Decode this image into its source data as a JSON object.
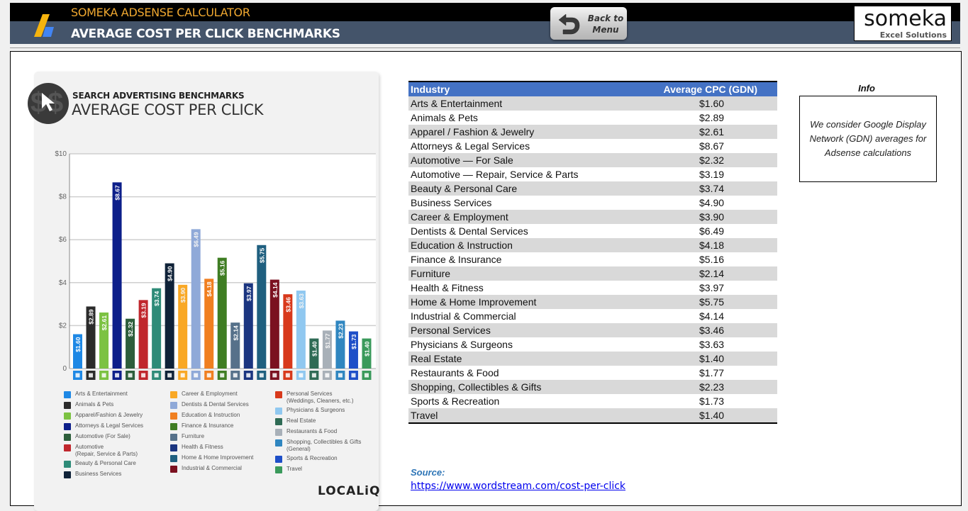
{
  "header": {
    "app_title": "SOMEKA ADSENSE CALCULATOR",
    "page_title": "AVERAGE COST PER CLICK BENCHMARKS",
    "back_button": {
      "line1": "Back to",
      "line2": "Menu"
    },
    "brand": {
      "name": "someka",
      "tagline": "Excel Solutions"
    }
  },
  "infographic": {
    "subtitle": "SEARCH ADVERTISING BENCHMARKS",
    "title": "AVERAGE COST PER CLICK",
    "brand": "LOCALiQ",
    "legend_columns": [
      [
        {
          "label": "Arts & Entertainment",
          "color": "#1e88e5"
        },
        {
          "label": "Animals & Pets",
          "color": "#2b2b2b"
        },
        {
          "label": "Apparel/Fashion & Jewelry",
          "color": "#7cc242"
        },
        {
          "label": "Attorneys & Legal Services",
          "color": "#0d1f8a"
        },
        {
          "label": "Automotive (For Sale)",
          "color": "#2d5e3b"
        },
        {
          "label": "Automotive",
          "label2": "(Repair, Service & Parts)",
          "color": "#c0272d"
        },
        {
          "label": "Beauty & Personal Care",
          "color": "#2e8b78"
        },
        {
          "label": "Business Services",
          "color": "#0f2238"
        }
      ],
      [
        {
          "label": "Career & Employment",
          "color": "#f9a825"
        },
        {
          "label": "Dentists & Dental Services",
          "color": "#8fa9d8"
        },
        {
          "label": "Education & Instruction",
          "color": "#f07f20"
        },
        {
          "label": "Finance & Insurance",
          "color": "#3f7d23"
        },
        {
          "label": "Furniture",
          "color": "#56718a"
        },
        {
          "label": "Health & Fitness",
          "color": "#1b3580"
        },
        {
          "label": "Home & Home Improvement",
          "color": "#1f5f7f"
        },
        {
          "label": "Industrial & Commercial",
          "color": "#7b1120"
        }
      ],
      [
        {
          "label": "Personal Services",
          "label2": "(Weddings, Cleaners, etc.)",
          "color": "#d8391b"
        },
        {
          "label": "Physicians & Surgeons",
          "color": "#90c8f0"
        },
        {
          "label": "Real Estate",
          "color": "#2f6b55"
        },
        {
          "label": "Restaurants & Food",
          "color": "#a8b0b8"
        },
        {
          "label": "Shopping, Collectibles & Gifts",
          "label2": "(General)",
          "color": "#2f86c0"
        },
        {
          "label": "Sports & Recreation",
          "color": "#1e4fc8"
        },
        {
          "label": "Travel",
          "color": "#3a9a5b"
        }
      ]
    ]
  },
  "chart_data": {
    "type": "bar",
    "title": "AVERAGE COST PER CLICK",
    "subtitle": "SEARCH ADVERTISING BENCHMARKS",
    "xlabel": "",
    "ylabel": "",
    "ylim": [
      0,
      10
    ],
    "yticks": [
      "0",
      "$2",
      "$4",
      "$6",
      "$8",
      "$10"
    ],
    "ytick_values": [
      0,
      2,
      4,
      6,
      8,
      10
    ],
    "grid": true,
    "categories": [
      "Arts & Entertainment",
      "Animals & Pets",
      "Apparel / Fashion & Jewelry",
      "Attorneys & Legal Services",
      "Automotive — For Sale",
      "Automotive — Repair, Service & Parts",
      "Beauty & Personal Care",
      "Business Services",
      "Career & Employment",
      "Dentists & Dental Services",
      "Education & Instruction",
      "Finance & Insurance",
      "Furniture",
      "Health & Fitness",
      "Home & Home Improvement",
      "Industrial & Commercial",
      "Personal Services",
      "Physicians & Surgeons",
      "Real Estate",
      "Restaurants & Food",
      "Shopping, Collectibles & Gifts",
      "Sports & Recreation",
      "Travel"
    ],
    "values": [
      1.6,
      2.89,
      2.61,
      8.67,
      2.32,
      3.19,
      3.74,
      4.9,
      3.9,
      6.49,
      4.18,
      5.16,
      2.14,
      3.97,
      5.75,
      4.14,
      3.46,
      3.63,
      1.4,
      1.77,
      2.23,
      1.73,
      1.4
    ],
    "labels": [
      "$1.60",
      "$2.89",
      "$2.61",
      "$8.67",
      "$2.32",
      "$3.19",
      "$3.74",
      "$4.90",
      "$3.90",
      "$6.49",
      "$4.18",
      "$5.16",
      "$2.14",
      "$3.97",
      "$5.75",
      "$4.14",
      "$3.46",
      "$3.63",
      "$1.40",
      "$1.77",
      "$2.23",
      "$1.73",
      "$1.40"
    ],
    "colors": [
      "#1e88e5",
      "#2b2b2b",
      "#7cc242",
      "#0d1f8a",
      "#2d5e3b",
      "#c0272d",
      "#2e8b78",
      "#0f2238",
      "#f9a825",
      "#8fa9d8",
      "#f07f20",
      "#3f7d23",
      "#56718a",
      "#1b3580",
      "#1f5f7f",
      "#7b1120",
      "#d8391b",
      "#90c8f0",
      "#2f6b55",
      "#a8b0b8",
      "#2f86c0",
      "#1e4fc8",
      "#3a9a5b"
    ]
  },
  "table": {
    "headers": [
      "Industry",
      "Average CPC (GDN)"
    ],
    "rows": [
      [
        "Arts & Entertainment",
        "$1.60"
      ],
      [
        "Animals & Pets",
        "$2.89"
      ],
      [
        "Apparel / Fashion & Jewelry",
        "$2.61"
      ],
      [
        "Attorneys & Legal Services",
        "$8.67"
      ],
      [
        "Automotive — For Sale",
        "$2.32"
      ],
      [
        "Automotive — Repair, Service & Parts",
        "$3.19"
      ],
      [
        "Beauty & Personal Care",
        "$3.74"
      ],
      [
        "Business Services",
        "$4.90"
      ],
      [
        "Career & Employment",
        "$3.90"
      ],
      [
        "Dentists & Dental Services",
        "$6.49"
      ],
      [
        "Education & Instruction",
        "$4.18"
      ],
      [
        "Finance & Insurance",
        "$5.16"
      ],
      [
        "Furniture",
        "$2.14"
      ],
      [
        "Health & Fitness",
        "$3.97"
      ],
      [
        "Home & Home Improvement",
        "$5.75"
      ],
      [
        "Industrial & Commercial",
        "$4.14"
      ],
      [
        "Personal Services",
        "$3.46"
      ],
      [
        "Physicians & Surgeons",
        "$3.63"
      ],
      [
        "Real Estate",
        "$1.40"
      ],
      [
        "Restaurants & Food",
        "$1.77"
      ],
      [
        "Shopping, Collectibles & Gifts",
        "$2.23"
      ],
      [
        "Sports & Recreation",
        "$1.73"
      ],
      [
        "Travel",
        "$1.40"
      ]
    ]
  },
  "info": {
    "heading": "Info",
    "text": "We consider Google Display Network (GDN) averages for Adsense calculations"
  },
  "source": {
    "label": "Source:",
    "url": "https://www.wordstream.com/cost-per-click"
  }
}
